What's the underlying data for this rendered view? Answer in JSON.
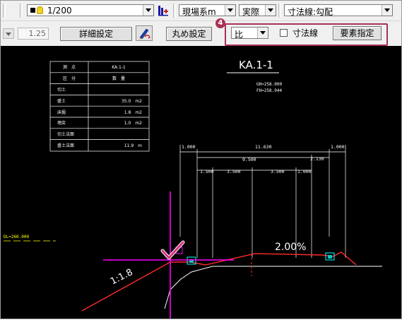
{
  "toolbar1": {
    "layer_scale": "1/200",
    "coord_system": "現場系m",
    "display_mode": "実際",
    "dimension_line": "寸法線:勾配"
  },
  "toolbar2": {
    "scale_value": "1.25",
    "detail_button": "詳細設定",
    "round_button": "丸め設定",
    "callout_number": "4",
    "ratio_select": "比",
    "dimension_checkbox_label": "寸法線",
    "dimension_checked": false,
    "element_button": "要素指定",
    "accent_color": "#a83254"
  },
  "drawing": {
    "quantity_table": {
      "rows": [
        [
          "測　点",
          "KA.1-1"
        ],
        [
          "区　分",
          "数　量"
        ],
        [
          "切土",
          ""
        ],
        [
          "盛土",
          "35.0　m2"
        ],
        [
          "床掘",
          "1.8　m2"
        ],
        [
          "埋戻",
          "1.0　m2"
        ],
        [
          "切土法面",
          ""
        ],
        [
          "盛土法面",
          "11.9　m"
        ]
      ]
    },
    "station_title": "KA.1-1",
    "gh": "GH=258.000",
    "fh": "FH=258.944",
    "dl_label": "DL=260.000",
    "dimensions_row1": [
      "1.000",
      "11.630",
      "1.000"
    ],
    "dimensions_row2": [
      "9.500",
      "2.130"
    ],
    "dimensions_row3": [
      "1.500",
      "3.500",
      "3.500",
      "1.000"
    ],
    "slope_percent": "2.00%",
    "slope_ratio": "1:1.8",
    "colors": {
      "background": "#000000",
      "white_lines": "#ffffff",
      "road_line": "#ff2a2a",
      "cursor": "#ff00ff",
      "text_yellow": "#ffff00",
      "structure_cyan": "#00ffff",
      "check_mark": "#d2337a"
    }
  }
}
